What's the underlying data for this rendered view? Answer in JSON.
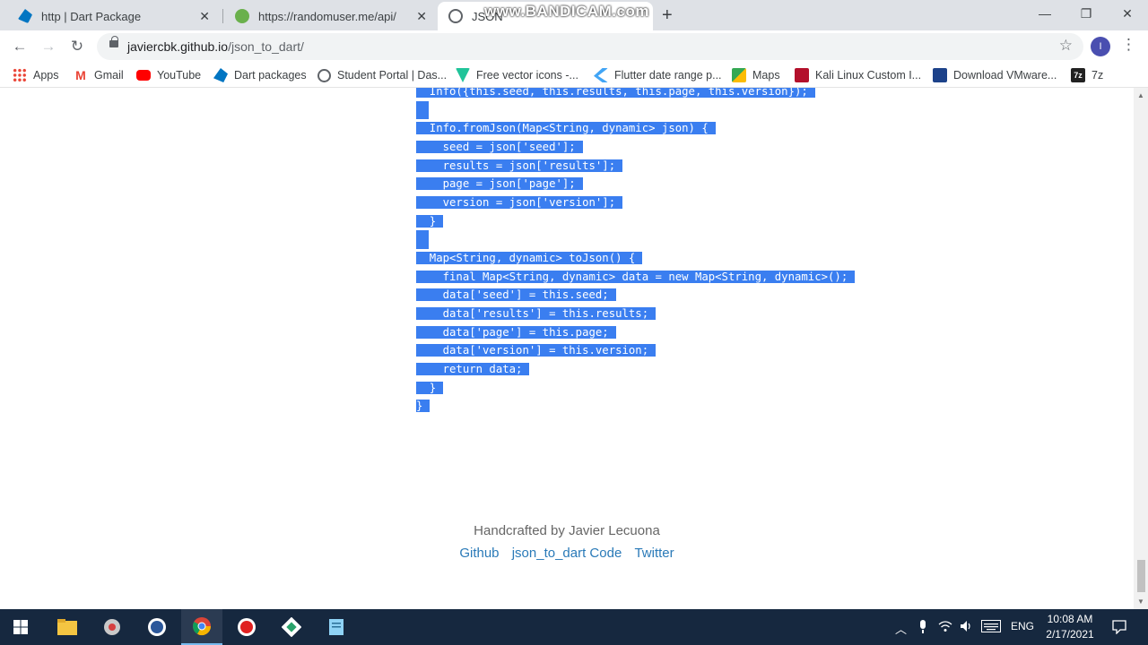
{
  "tabs": [
    {
      "title": "http | Dart Package"
    },
    {
      "title": "https://randomuser.me/api/"
    },
    {
      "title": "JSON"
    }
  ],
  "watermark": "www.BANDICAM.com",
  "window_controls": {
    "minimize": "—",
    "restore": "❐",
    "close": "✕"
  },
  "toolbar": {
    "url_host": "javiercbk.github.io",
    "url_path": "/json_to_dart/",
    "profile_initial": "I"
  },
  "bookmarks": [
    {
      "label": "Apps",
      "icon": "apps-grid-icon"
    },
    {
      "label": "Gmail",
      "icon": "gmail-icon"
    },
    {
      "label": "YouTube",
      "icon": "youtube-icon"
    },
    {
      "label": "Dart packages",
      "icon": "dart-icon"
    },
    {
      "label": "Student Portal | Das...",
      "icon": "globe-icon"
    },
    {
      "label": "Free vector icons -...",
      "icon": "vector-icon"
    },
    {
      "label": "Flutter date range p...",
      "icon": "flutter-icon"
    },
    {
      "label": "Maps",
      "icon": "maps-icon"
    },
    {
      "label": "Kali Linux Custom I...",
      "icon": "kali-icon"
    },
    {
      "label": "Download VMware...",
      "icon": "vmware-icon"
    },
    {
      "label": "7z",
      "icon": "7zip-icon"
    }
  ],
  "code_lines": [
    "  Info({this.seed, this.results, this.page, this.version});",
    "",
    "  Info.fromJson(Map<String, dynamic> json) {",
    "    seed = json['seed'];",
    "    results = json['results'];",
    "    page = json['page'];",
    "    version = json['version'];",
    "  }",
    "",
    "  Map<String, dynamic> toJson() {",
    "    final Map<String, dynamic> data = new Map<String, dynamic>();",
    "    data['seed'] = this.seed;",
    "    data['results'] = this.results;",
    "    data['page'] = this.page;",
    "    data['version'] = this.version;",
    "    return data;",
    "  }",
    "}"
  ],
  "footer": {
    "handcrafted": "Handcrafted by Javier Lecuona",
    "links": [
      "Github",
      "json_to_dart Code",
      "Twitter"
    ]
  },
  "taskbar": {
    "apps": [
      "windows-start-icon",
      "file-explorer-icon",
      "app-icon",
      "word-icon",
      "chrome-icon",
      "bandicam-record-icon",
      "app-icon-2",
      "notepad-icon"
    ],
    "language": "ENG",
    "time": "10:08 AM",
    "date": "2/17/2021"
  },
  "colors": {
    "selection": "#3a7ef0",
    "link": "#2a7ab8",
    "taskbar": "#16283f"
  }
}
